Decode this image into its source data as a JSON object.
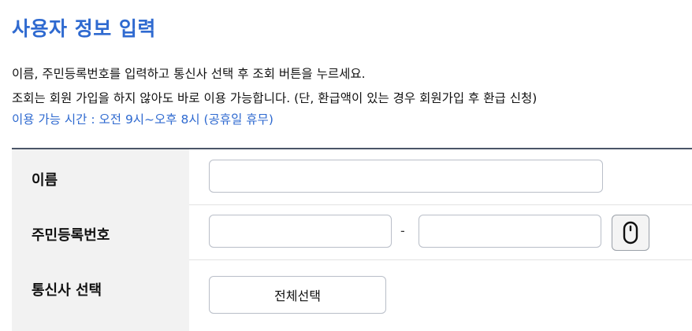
{
  "page": {
    "title": "사용자 정보 입력",
    "instructions": [
      "이름, 주민등록번호를 입력하고 통신사 선택 후 조회 버튼을 누르세요.",
      "조회는 회원 가입을 하지 않아도 바로 이용 가능합니다. (단, 환급액이 있는 경우 회원가입 후 환급 신청)",
      "이용 가능 시간 : 오전 9시~오후 8시 (공휴일 휴무)"
    ]
  },
  "form": {
    "name": {
      "label": "이름",
      "value": "",
      "placeholder": ""
    },
    "rrn": {
      "label": "주민등록번호",
      "front_value": "",
      "back_value": "",
      "separator": "-",
      "keypad_icon": "mouse-icon"
    },
    "carrier": {
      "label": "통신사 선택",
      "select_all_label": "전체선택"
    }
  },
  "colors": {
    "accent": "#2f6ad0",
    "label_bg": "#f2f2f2",
    "border": "#b9bec8",
    "table_top_border": "#4a5568"
  }
}
